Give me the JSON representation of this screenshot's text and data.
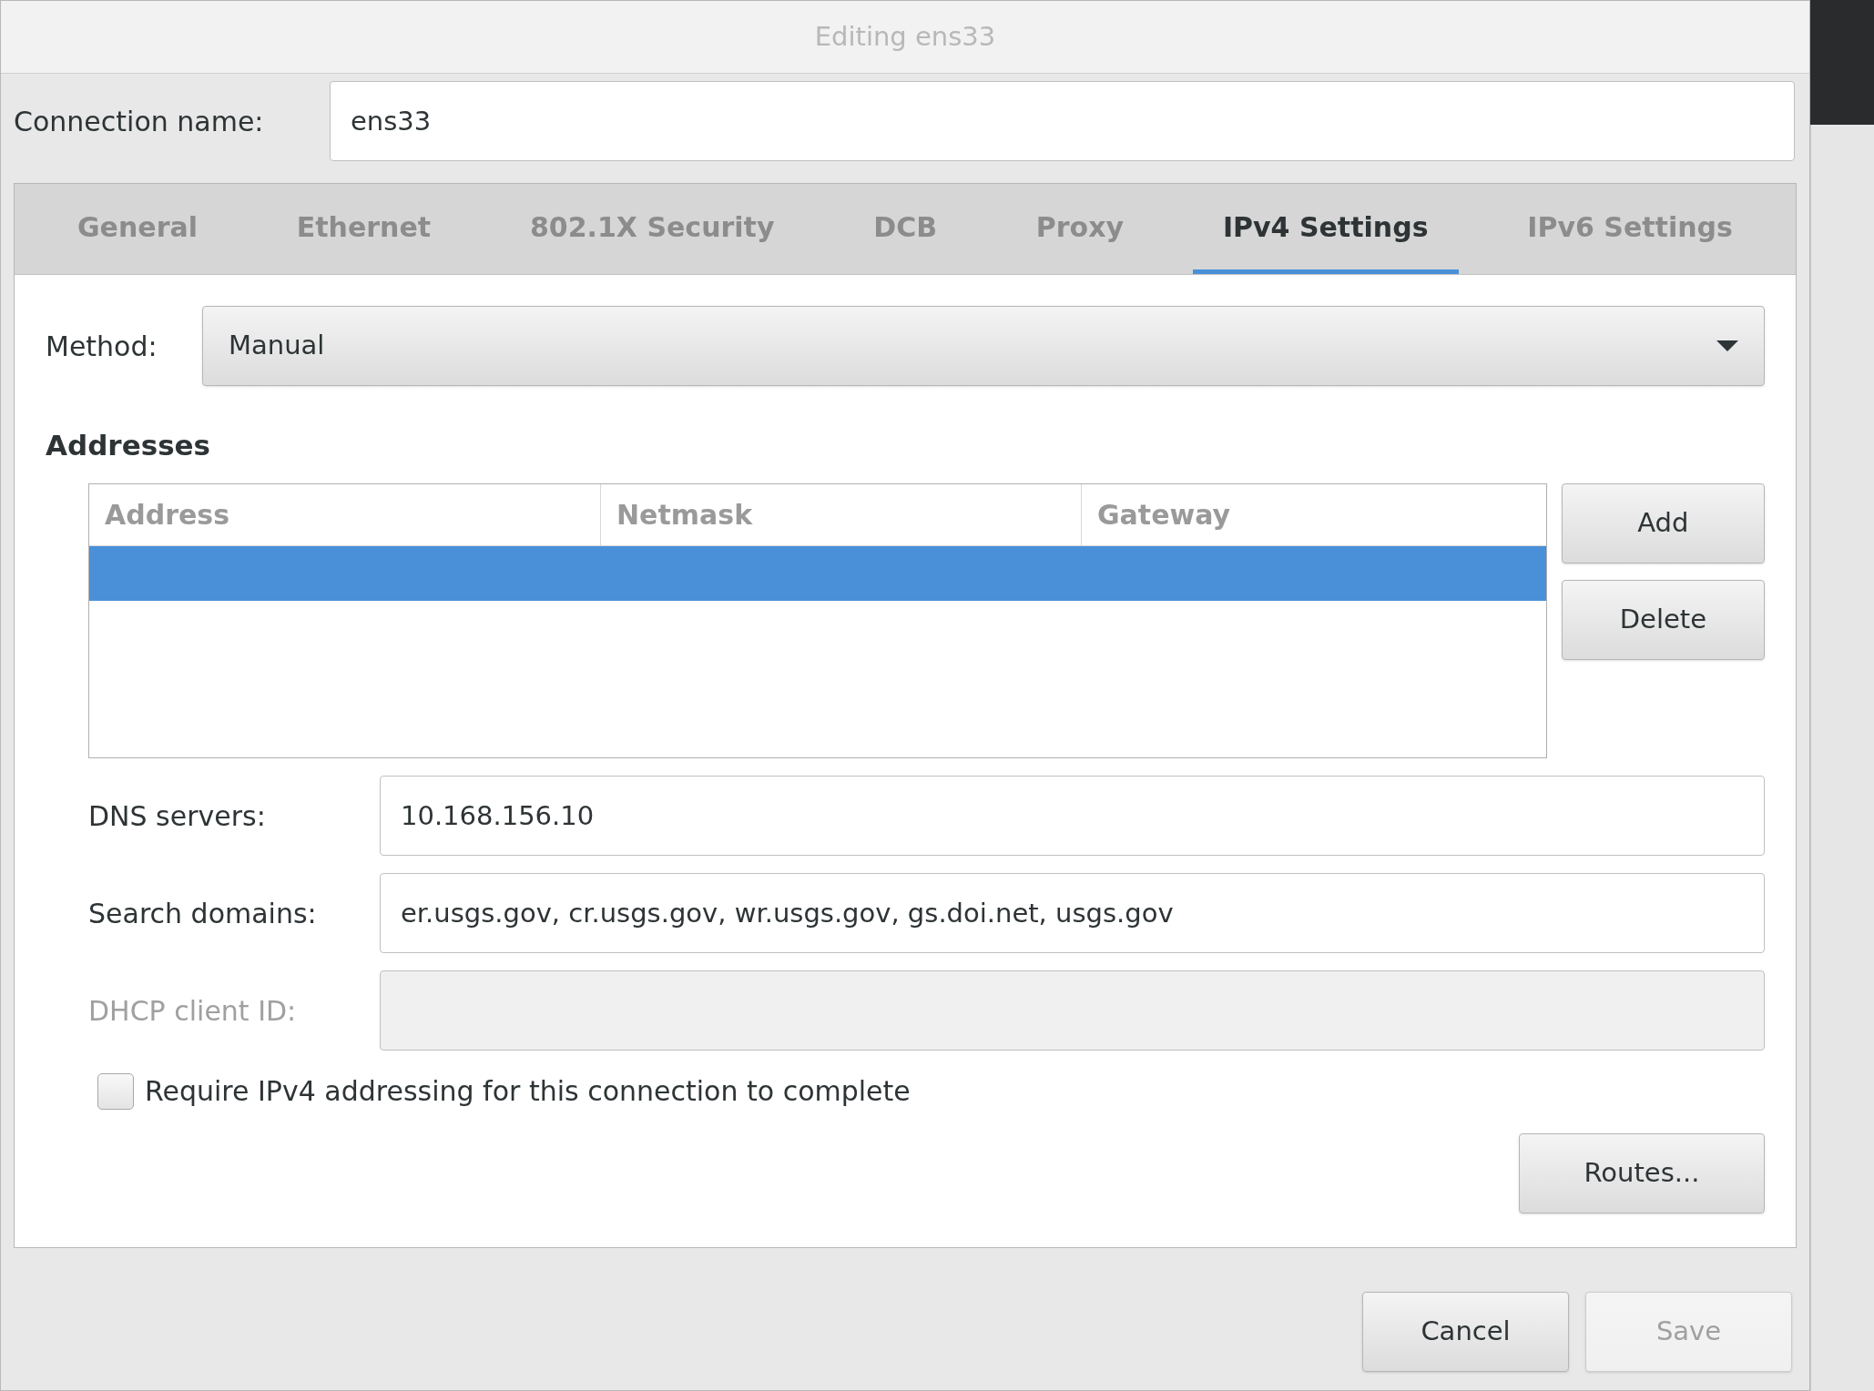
{
  "window": {
    "title": "Editing ens33"
  },
  "connection_name": {
    "label": "Connection name:",
    "value": "ens33"
  },
  "tabs": [
    {
      "label": "General",
      "selected": false
    },
    {
      "label": "Ethernet",
      "selected": false
    },
    {
      "label": "802.1X Security",
      "selected": false
    },
    {
      "label": "DCB",
      "selected": false
    },
    {
      "label": "Proxy",
      "selected": false
    },
    {
      "label": "IPv4 Settings",
      "selected": true
    },
    {
      "label": "IPv6 Settings",
      "selected": false
    }
  ],
  "method": {
    "label": "Method:",
    "value": "Manual"
  },
  "addresses": {
    "heading": "Addresses",
    "columns": [
      "Address",
      "Netmask",
      "Gateway"
    ],
    "rows": [
      {
        "selected": true
      }
    ],
    "buttons": [
      "Add",
      "Delete"
    ]
  },
  "fields": [
    {
      "label": "DNS servers:",
      "value": "10.168.156.10",
      "disabled": false
    },
    {
      "label": "Search domains:",
      "value": "er.usgs.gov, cr.usgs.gov, wr.usgs.gov, gs.doi.net, usgs.gov",
      "disabled": false
    },
    {
      "label": "DHCP client ID:",
      "disabled": true
    }
  ],
  "require_checkbox": {
    "label": "Require IPv4 addressing for this connection to complete",
    "checked": false
  },
  "routes_button": "Routes...",
  "footer_buttons": [
    {
      "label": "Cancel",
      "disabled": false
    },
    {
      "label": "Save",
      "disabled": true
    }
  ]
}
